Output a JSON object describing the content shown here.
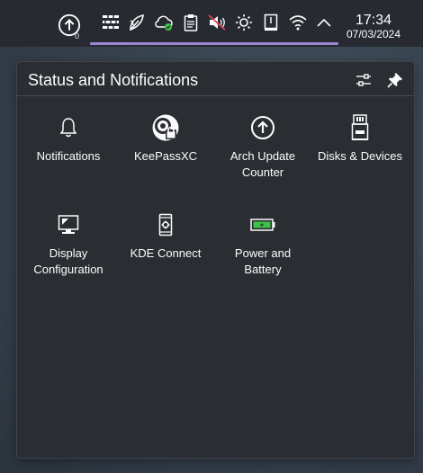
{
  "panel": {
    "update_count": "0",
    "clock_time": "17:34",
    "clock_date": "07/03/2024",
    "icons": [
      "arch-update-icon",
      "firewall-icon",
      "plasma-vault-icon",
      "cloud-sync-icon",
      "clipboard-icon",
      "volume-muted-icon",
      "brightness-icon",
      "battery-icon",
      "wifi-icon",
      "expand-tray-icon"
    ],
    "accent": "#9b86d6"
  },
  "popup": {
    "title": "Status and Notifications",
    "entries": [
      {
        "label": "Notifications",
        "icon": "bell-icon"
      },
      {
        "label": "KeePassXC",
        "icon": "keepassxc-icon"
      },
      {
        "label": "Arch Update\nCounter",
        "icon": "arch-update-icon"
      },
      {
        "label": "Disks & Devices",
        "icon": "usb-drive-icon"
      },
      {
        "label": "Display\nConfiguration",
        "icon": "display-icon"
      },
      {
        "label": "KDE Connect",
        "icon": "phone-icon"
      },
      {
        "label": "Power and\nBattery",
        "icon": "battery-icon"
      }
    ],
    "colors": {
      "background": "#2a2e33",
      "battery_green": "#3ec34a"
    }
  }
}
